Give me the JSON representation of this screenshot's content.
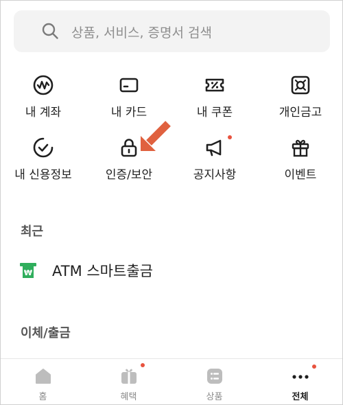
{
  "search": {
    "placeholder": "상품, 서비스, 증명서 검색"
  },
  "grid": [
    {
      "label": "내 계좌"
    },
    {
      "label": "내 카드"
    },
    {
      "label": "내 쿠폰"
    },
    {
      "label": "개인금고"
    },
    {
      "label": "내 신용정보"
    },
    {
      "label": "인증/보안"
    },
    {
      "label": "공지사항"
    },
    {
      "label": "이벤트"
    }
  ],
  "sections": {
    "recent_title": "최근",
    "transfer_title": "이체/출금"
  },
  "recent": [
    {
      "label": "ATM 스마트출금"
    }
  ],
  "bottom_nav": [
    {
      "label": "홈"
    },
    {
      "label": "혜택"
    },
    {
      "label": "상품"
    },
    {
      "label": "전체"
    }
  ],
  "colors": {
    "accent": "#e8533f",
    "arrow": "#e0613f",
    "atm_green": "#2fae5c",
    "nav_icon": "#bdbdbd"
  }
}
